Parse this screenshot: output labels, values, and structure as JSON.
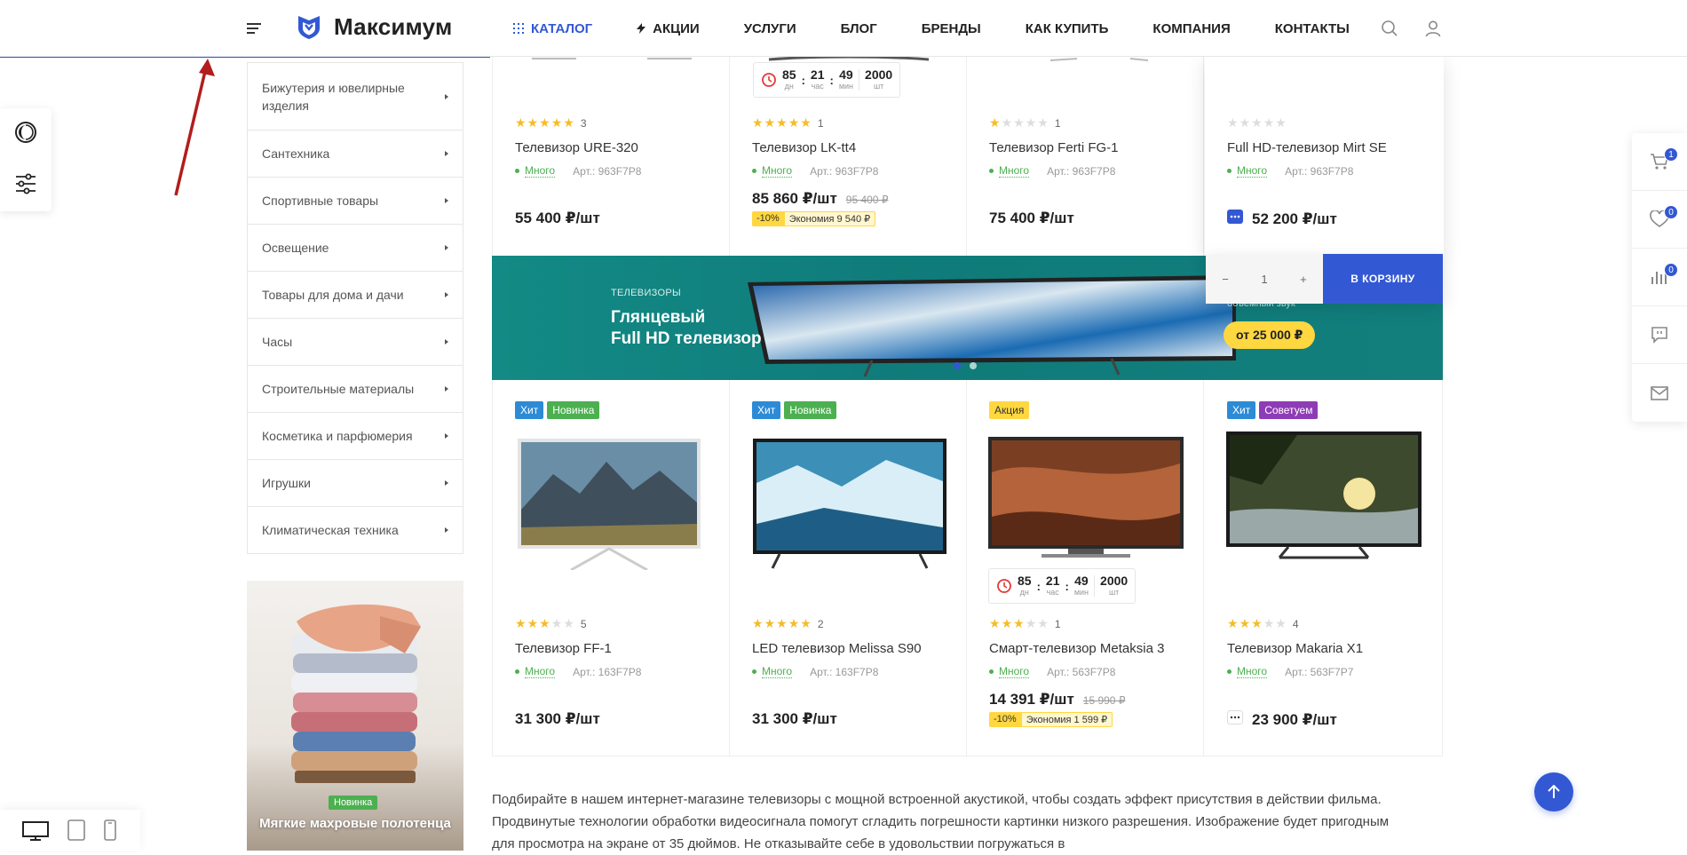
{
  "header": {
    "logo_text": "Максимум",
    "nav": [
      {
        "label": "Каталог",
        "active": true
      },
      {
        "label": "Акции"
      },
      {
        "label": "Услуги"
      },
      {
        "label": "Блог"
      },
      {
        "label": "Бренды"
      },
      {
        "label": "Как купить"
      },
      {
        "label": "Компания"
      },
      {
        "label": "Контакты"
      }
    ]
  },
  "sidebar": {
    "categories": [
      "Бижутерия и ювелирные изделия",
      "Сантехника",
      "Спортивные товары",
      "Освещение",
      "Товары для дома и дачи",
      "Часы",
      "Строительные материалы",
      "Косметика и парфюмерия",
      "Игрушки",
      "Климатическая техника"
    ],
    "promo": {
      "badge": "Новинка",
      "title": "Мягкие махровые полотенца"
    }
  },
  "right_panel": {
    "cart_count": "1",
    "favorites_count": "0",
    "compare_count": "0"
  },
  "timer_labels": {
    "days": "дн",
    "hours": "час",
    "minutes": "мин",
    "pieces": "шт"
  },
  "products_row1": [
    {
      "rating": 5,
      "reviews": "3",
      "name": "Телевизор URE-320",
      "stock": "Много",
      "article": "Арт.: 963F7P8",
      "price": "55 400 ₽/шт"
    },
    {
      "rating": 5,
      "reviews": "1",
      "name": "Телевизор LK-tt4",
      "stock": "Много",
      "article": "Арт.: 963F7P8",
      "price": "85 860 ₽/шт",
      "old_price": "95 400 ₽",
      "discount": "-10%",
      "economy": "Экономия 9 540 ₽",
      "timer": {
        "days": "85",
        "hours": "21",
        "minutes": "49",
        "pieces": "2000"
      }
    },
    {
      "rating": 1,
      "reviews": "1",
      "name": "Телевизор Ferti FG-1",
      "stock": "Много",
      "article": "Арт.: 963F7P8",
      "price": "75 400 ₽/шт"
    },
    {
      "rating": 0,
      "reviews": "",
      "name": "Full HD-телевизор Mirt SE",
      "stock": "Много",
      "article": "Арт.: 963F7P8",
      "price": "52 200 ₽/шт"
    }
  ],
  "cart_bar": {
    "qty": "1",
    "minus": "−",
    "plus": "+",
    "button": "В корзину"
  },
  "banner": {
    "subtitle": "Телевизоры",
    "title_line1": "Глянцевый",
    "title_line2": "Full HD телевизор",
    "right_text": "объемный звук",
    "price_tag": "от 25 000 ₽"
  },
  "products_row2": [
    {
      "tags": [
        {
          "label": "Хит",
          "kind": "hit"
        },
        {
          "label": "Новинка",
          "kind": "new"
        }
      ],
      "rating": 3,
      "reviews": "5",
      "name": "Телевизор FF-1",
      "stock": "Много",
      "article": "Арт.: 163F7P8",
      "price": "31 300 ₽/шт"
    },
    {
      "tags": [
        {
          "label": "Хит",
          "kind": "hit"
        },
        {
          "label": "Новинка",
          "kind": "new"
        }
      ],
      "rating": 5,
      "reviews": "2",
      "name": "LED телевизор Melissa S90",
      "stock": "Много",
      "article": "Арт.: 163F7P8",
      "price": "31 300 ₽/шт"
    },
    {
      "tags": [
        {
          "label": "Акция",
          "kind": "sale"
        }
      ],
      "rating": 3,
      "reviews": "1",
      "name": "Смарт-телевизор Metaksia 3",
      "stock": "Много",
      "article": "Арт.: 563F7P8",
      "price": "14 391 ₽/шт",
      "old_price": "15 990 ₽",
      "discount": "-10%",
      "economy": "Экономия 1 599 ₽",
      "timer": {
        "days": "85",
        "hours": "21",
        "minutes": "49",
        "pieces": "2000"
      }
    },
    {
      "tags": [
        {
          "label": "Хит",
          "kind": "hit"
        },
        {
          "label": "Советуем",
          "kind": "rec"
        }
      ],
      "rating": 3,
      "reviews": "4",
      "name": "Телевизор Makaria X1",
      "stock": "Много",
      "article": "Арт.: 563F7P7",
      "price": "23 900 ₽/шт"
    }
  ],
  "description": "Подбирайте в нашем интернет-магазине телевизоры с мощной встроенной акустикой, чтобы создать эффект присутствия в действии фильма. Продвинутые технологии обработки видеосигнала помогут сгладить погрешности картинки низкого разрешения. Изображение будет пригодным для просмотра на экране от 35 дюймов. Не отказывайте себе в удовольствии погружаться в",
  "colors": {
    "accent": "#3358d4",
    "stock": "#4cb050",
    "star": "#f3bd2a",
    "banner": "#138a85",
    "badge_yellow": "#ffd740"
  }
}
